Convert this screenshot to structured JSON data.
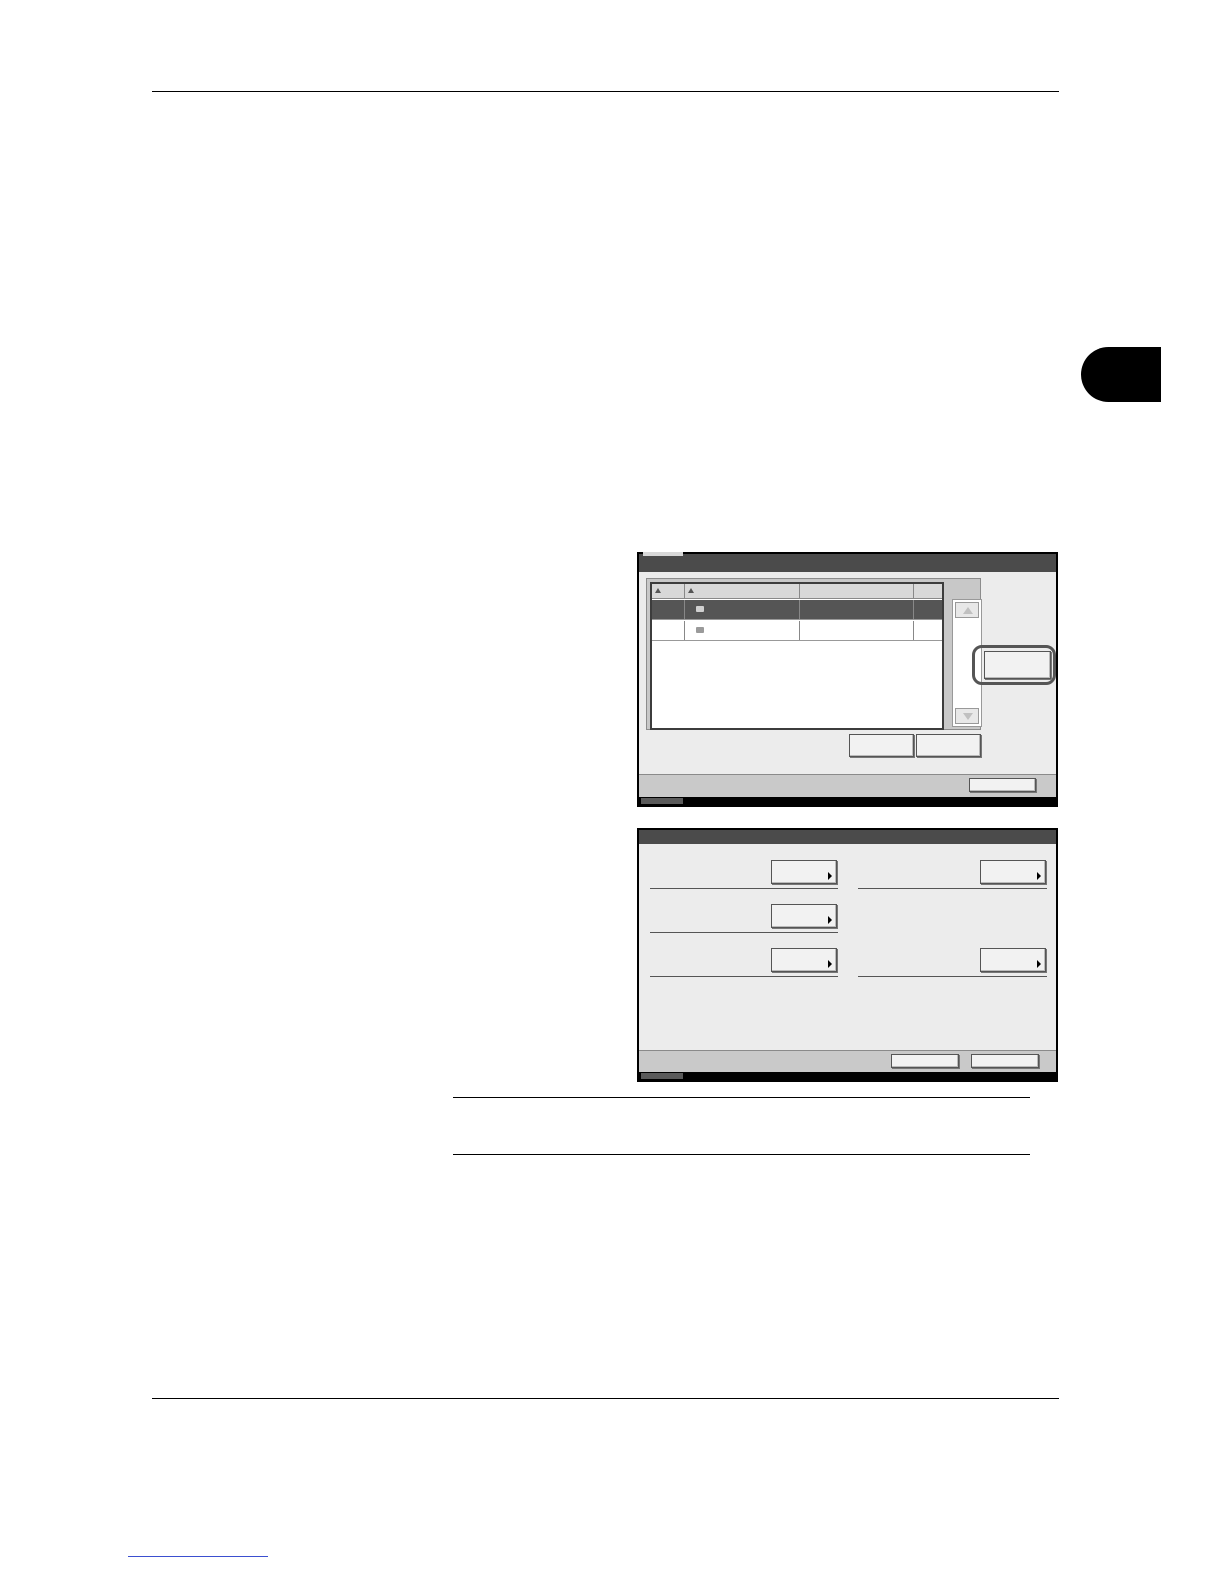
{
  "page": {
    "chapter_tab_color": "#000000",
    "link_color": "#3b4fd0"
  },
  "screen1": {
    "title": "",
    "list": {
      "columns": [
        "",
        "",
        "",
        ""
      ],
      "rows": [
        {
          "selected": true,
          "cells": [
            "",
            "",
            "",
            ""
          ]
        },
        {
          "selected": false,
          "cells": [
            "",
            "",
            "",
            ""
          ]
        }
      ]
    },
    "highlighted_button_label": "",
    "button_left_label": "",
    "button_right_label": "",
    "bottom_button_label": ""
  },
  "screen2": {
    "title": "",
    "settings": [
      {
        "label": "",
        "button": ""
      },
      {
        "label": "",
        "button": ""
      },
      {
        "label": "",
        "button": ""
      },
      {
        "label": "",
        "button": ""
      },
      {
        "label": "",
        "button": ""
      }
    ],
    "bottom_button_1": "",
    "bottom_button_2": ""
  }
}
